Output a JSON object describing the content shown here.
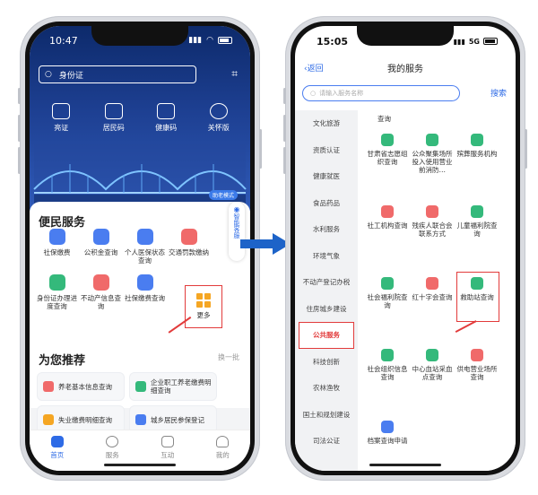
{
  "left_phone": {
    "status": {
      "time": "10:47",
      "signal": "",
      "wifi": "",
      "battery": ""
    },
    "search": {
      "placeholder": "身份证"
    },
    "quick_actions": [
      "亮证",
      "居民码",
      "健康码",
      "关怀版"
    ],
    "badge": "助老模式",
    "service_section": {
      "title": "便民服务",
      "items": [
        {
          "label": "社保缴费",
          "color": "#4a7df0"
        },
        {
          "label": "公积金查询",
          "color": "#4a7df0"
        },
        {
          "label": "个人医保状态查询",
          "color": "#4a7df0"
        },
        {
          "label": "交通罚款缴纳",
          "color": "#f06a6a"
        },
        {
          "label": "身份证办理进度查询",
          "color": "#34b97b"
        },
        {
          "label": "不动产信息查询",
          "color": "#f06a6a"
        },
        {
          "label": "社保缴费查询",
          "color": "#4a7df0"
        }
      ],
      "more_label": "更多"
    },
    "floating_button": "智能客服",
    "recommend": {
      "title": "为您推荐",
      "refresh": "换一批",
      "items": [
        {
          "label": "养老基本信息查询",
          "color": "#f06a6a"
        },
        {
          "label": "企业职工养老缴费明细查询",
          "color": "#34b97b"
        },
        {
          "label": "失业缴费明细查询",
          "color": "#f5a623"
        },
        {
          "label": "城乡居民参保登记",
          "color": "#4a7df0"
        }
      ]
    },
    "tabs": [
      {
        "label": "首页",
        "active": true
      },
      {
        "label": "服务",
        "active": false
      },
      {
        "label": "互动",
        "active": false
      },
      {
        "label": "我的",
        "active": false
      }
    ]
  },
  "right_phone": {
    "status": {
      "time": "15:05",
      "network": "5G"
    },
    "nav": {
      "back": "返回",
      "title": "我的服务"
    },
    "search": {
      "placeholder": "请输入服务名称",
      "button": "搜索"
    },
    "menu": [
      "文化旅游",
      "资质认证",
      "健康就医",
      "食品药品",
      "水利服务",
      "环境气象",
      "不动产登记办税",
      "住房城乡建设",
      "公共服务",
      "科技创新",
      "农林渔牧",
      "国土和规划建设",
      "司法公证"
    ],
    "active_menu": "公共服务",
    "top_partial_text": "查询",
    "services": [
      {
        "label": "甘肃省志愿组织查询",
        "color": "#34b97b"
      },
      {
        "label": "公众聚集场所投入使用营业前消防…",
        "color": "#34b97b"
      },
      {
        "label": "殡葬服务机构",
        "color": "#34b97b"
      },
      {
        "label": "社工机构查询",
        "color": "#f06a6a"
      },
      {
        "label": "残疾人联合会联系方式",
        "color": "#f06a6a"
      },
      {
        "label": "儿童福利院查询",
        "color": "#34b97b"
      },
      {
        "label": "社会福利院查询",
        "color": "#34b97b"
      },
      {
        "label": "红十字会查询",
        "color": "#f06a6a"
      },
      {
        "label": "救助站查询",
        "color": "#34b97b"
      },
      {
        "label": "社会组织信息查询",
        "color": "#34b97b"
      },
      {
        "label": "中心血站采血点查询",
        "color": "#34b97b"
      },
      {
        "label": "供电营业场所查询",
        "color": "#f06a6a"
      },
      {
        "label": "档案查询申请",
        "color": "#4a7df0"
      }
    ]
  }
}
